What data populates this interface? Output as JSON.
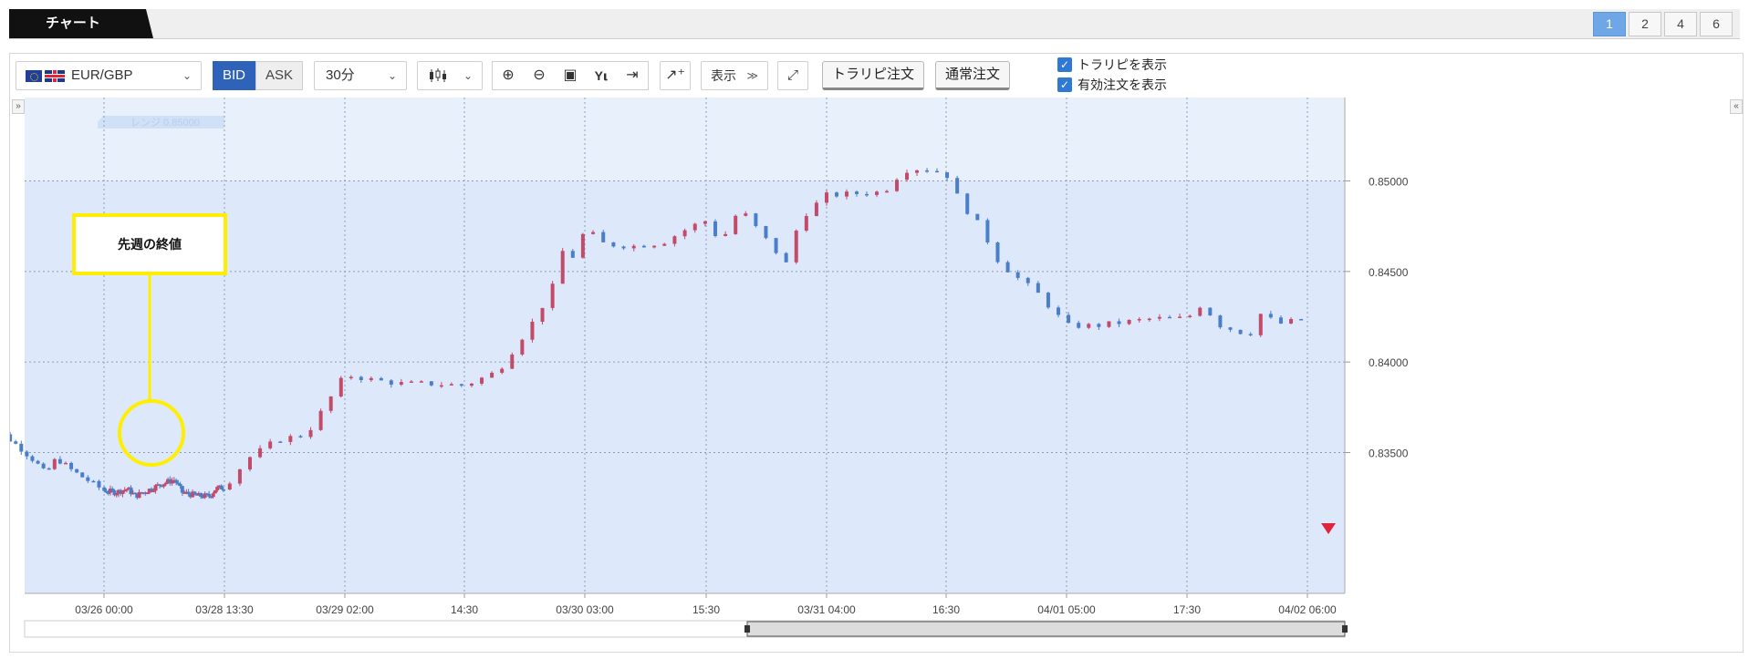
{
  "tabbar": {
    "title": "チャート",
    "layouts": [
      "1",
      "2",
      "4",
      "6"
    ],
    "active_layout": "1"
  },
  "toolbar": {
    "symbol": "EUR/GBP",
    "symbol_icons": [
      "eu-flag-icon",
      "uk-flag-icon"
    ],
    "price_side": {
      "bid": "BID",
      "ask": "ASK",
      "selected": "BID"
    },
    "timeframe": "30分",
    "chart_type_icon": "candlestick-icon",
    "tool_icons": [
      "zoom-in-icon",
      "zoom-out-icon",
      "fit-icon",
      "y-lock-icon",
      "scroll-end-icon"
    ],
    "indicator_icon": "add-indicator-icon",
    "display_label": "表示",
    "expand_icon": "expand-icon",
    "trap_repeat_button": "トラリピ注文",
    "normal_order_button": "通常注文",
    "checkboxes": [
      {
        "label": "トラリピを表示",
        "checked": true
      },
      {
        "label": "有効注文を表示",
        "checked": true
      }
    ]
  },
  "annotation": {
    "text": "先週の終値",
    "color": "#ffee00"
  },
  "colors": {
    "up": "#c44a6a",
    "down": "#4a7ec9",
    "plot_bg": "#dde9fb",
    "range_bg": "#cfe0f7",
    "accent": "#2f62b9"
  },
  "chart_data": {
    "type": "candlestick",
    "symbol": "EUR/GBP",
    "interval": "30分",
    "range_label": "レンジ 0.85000",
    "yticks": [
      "0.85000",
      "0.84500",
      "0.84000",
      "0.83500"
    ],
    "xticks": [
      "03/26 00:00",
      "03/28 13:30",
      "03/29 02:00",
      "14:30",
      "03/30 03:00",
      "15:30",
      "03/31 04:00",
      "16:30",
      "04/01 05:00",
      "17:30",
      "04/02 06:00"
    ],
    "ylim": [
      0.83,
      0.852
    ],
    "close_path": [
      [
        "03/25 00:00",
        0.8355
      ],
      [
        "03/25 02:00",
        0.8363
      ],
      [
        "03/25 05:00",
        0.836
      ],
      [
        "03/25 08:00",
        0.8353
      ],
      [
        "03/25 11:00",
        0.8345
      ],
      [
        "03/25 13:00",
        0.8338
      ],
      [
        "03/25 15:00",
        0.8347
      ],
      [
        "03/25 18:00",
        0.834
      ],
      [
        "03/26 00:00",
        0.8329
      ],
      [
        "03/26 06:00",
        0.8328
      ],
      [
        "03/26 12:00",
        0.833
      ],
      [
        "03/26 16:00",
        0.8326
      ],
      [
        "03/27 00:00",
        0.833
      ],
      [
        "03/27 06:00",
        0.8333
      ],
      [
        "03/27 12:00",
        0.8335
      ],
      [
        "03/27 16:00",
        0.8328
      ],
      [
        "03/28 00:00",
        0.8326
      ],
      [
        "03/28 06:00",
        0.8326
      ],
      [
        "03/28 09:00",
        0.833
      ],
      [
        "03/28 13:30",
        0.8331
      ],
      [
        "03/28 16:00",
        0.8347
      ],
      [
        "03/28 19:00",
        0.8357
      ],
      [
        "03/28 22:00",
        0.836
      ],
      [
        "03/29 00:00",
        0.8376
      ],
      [
        "03/29 02:00",
        0.8393
      ],
      [
        "03/29 05:00",
        0.839
      ],
      [
        "03/29 08:00",
        0.8388
      ],
      [
        "03/29 11:00",
        0.8388
      ],
      [
        "03/29 14:30",
        0.8387
      ],
      [
        "03/29 18:00",
        0.8395
      ],
      [
        "03/29 22:00",
        0.8425
      ],
      [
        "03/30 00:00",
        0.8445
      ],
      [
        "03/30 01:00",
        0.8468
      ],
      [
        "03/30 02:00",
        0.8455
      ],
      [
        "03/30 03:00",
        0.8474
      ],
      [
        "03/30 05:00",
        0.8465
      ],
      [
        "03/30 08:00",
        0.8464
      ],
      [
        "03/30 11:00",
        0.8466
      ],
      [
        "03/30 14:00",
        0.8475
      ],
      [
        "03/30 15:30",
        0.8478
      ],
      [
        "03/30 17:00",
        0.8466
      ],
      [
        "03/30 19:00",
        0.8485
      ],
      [
        "03/30 21:00",
        0.8472
      ],
      [
        "03/31 00:00",
        0.8453
      ],
      [
        "03/31 01:00",
        0.8476
      ],
      [
        "03/31 02:00",
        0.8483
      ],
      [
        "03/31 04:00",
        0.8492
      ],
      [
        "03/31 07:00",
        0.8493
      ],
      [
        "03/31 10:00",
        0.8494
      ],
      [
        "03/31 12:00",
        0.8506
      ],
      [
        "03/31 14:00",
        0.8507
      ],
      [
        "03/31 16:30",
        0.8504
      ],
      [
        "03/31 18:00",
        0.8488
      ],
      [
        "03/31 20:00",
        0.8475
      ],
      [
        "03/31 22:00",
        0.8455
      ],
      [
        "04/01 00:00",
        0.8446
      ],
      [
        "04/01 02:00",
        0.8438
      ],
      [
        "04/01 03:00",
        0.8432
      ],
      [
        "04/01 05:00",
        0.842
      ],
      [
        "04/01 08:00",
        0.842
      ],
      [
        "04/01 11:00",
        0.8422
      ],
      [
        "04/01 14:00",
        0.8424
      ],
      [
        "04/01 17:30",
        0.8424
      ],
      [
        "04/01 19:00",
        0.8432
      ],
      [
        "04/01 21:00",
        0.842
      ],
      [
        "04/02 00:00",
        0.8415
      ],
      [
        "04/02 01:00",
        0.8427
      ],
      [
        "04/02 03:00",
        0.8421
      ],
      [
        "04/02 06:00",
        0.8424
      ]
    ]
  },
  "last_price_marker_icon": "down-triangle-icon"
}
